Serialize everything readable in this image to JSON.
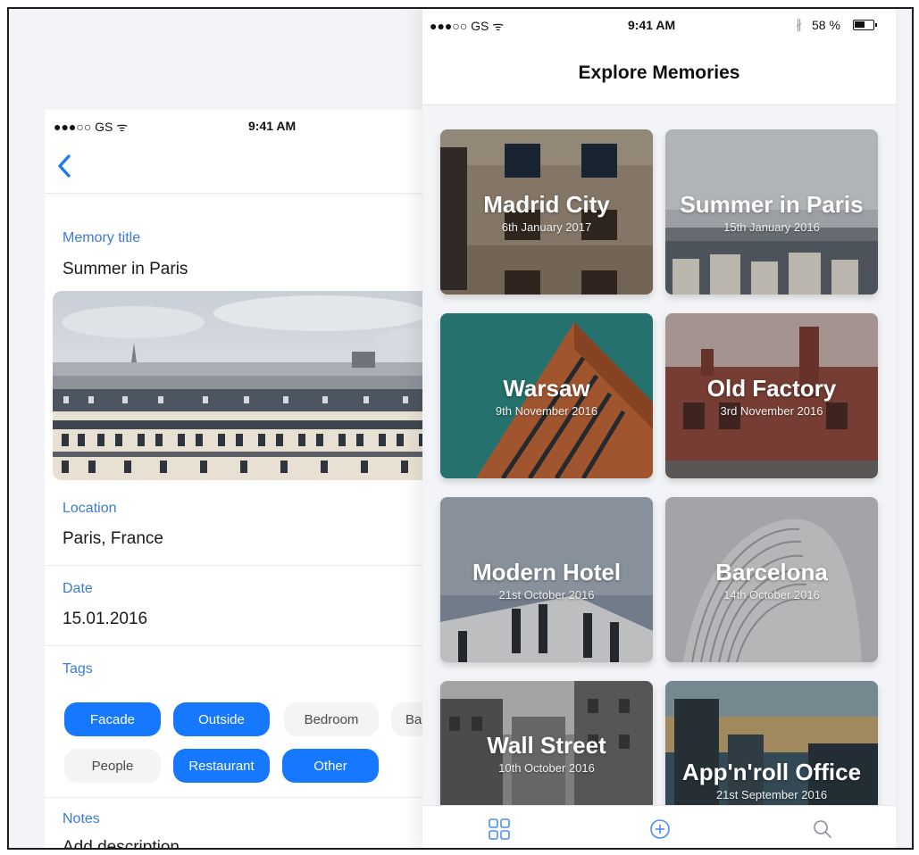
{
  "left": {
    "status": {
      "carrier": "●●●○○ GS ᯤ",
      "time": "9:41 AM"
    },
    "memory_title_label": "Memory title",
    "memory_title_value": "Summer in Paris",
    "location_label": "Location",
    "location_value": "Paris, France",
    "date_label": "Date",
    "date_value": "15.01.2016",
    "tags_label": "Tags",
    "tags": [
      {
        "label": "Facade",
        "selected": true
      },
      {
        "label": "Outside",
        "selected": true
      },
      {
        "label": "Bedroom",
        "selected": false
      },
      {
        "label": "Ba",
        "selected": false
      },
      {
        "label": "People",
        "selected": false
      },
      {
        "label": "Restaurant",
        "selected": true
      },
      {
        "label": "Other",
        "selected": true
      }
    ],
    "notes_label": "Notes",
    "notes_placeholder": "Add description"
  },
  "right": {
    "status": {
      "carrier": "●●●○○ GS ᯤ",
      "time": "9:41 AM",
      "bluetooth": "∦",
      "battery": "58 %"
    },
    "title": "Explore Memories",
    "cards": [
      {
        "title": "Madrid City",
        "date": "6th January 2017"
      },
      {
        "title": "Summer in Paris",
        "date": "15th January 2016"
      },
      {
        "title": "Warsaw",
        "date": "9th November 2016"
      },
      {
        "title": "Old Factory",
        "date": "3rd November 2016"
      },
      {
        "title": "Modern Hotel",
        "date": "21st October 2016"
      },
      {
        "title": "Barcelona",
        "date": "14th October 2016"
      },
      {
        "title": "Wall Street",
        "date": "10th October 2016"
      },
      {
        "title": "App'n'roll Office",
        "date": "21st September 2016"
      }
    ],
    "tabbar": {
      "icons": [
        "grid-icon",
        "add-circle-icon",
        "search-icon"
      ]
    }
  },
  "colors": {
    "accent": "#1677ff",
    "label_blue": "#3a7bd5",
    "tag_off_bg": "#f4f4f6",
    "background": "#f3f4f7"
  }
}
